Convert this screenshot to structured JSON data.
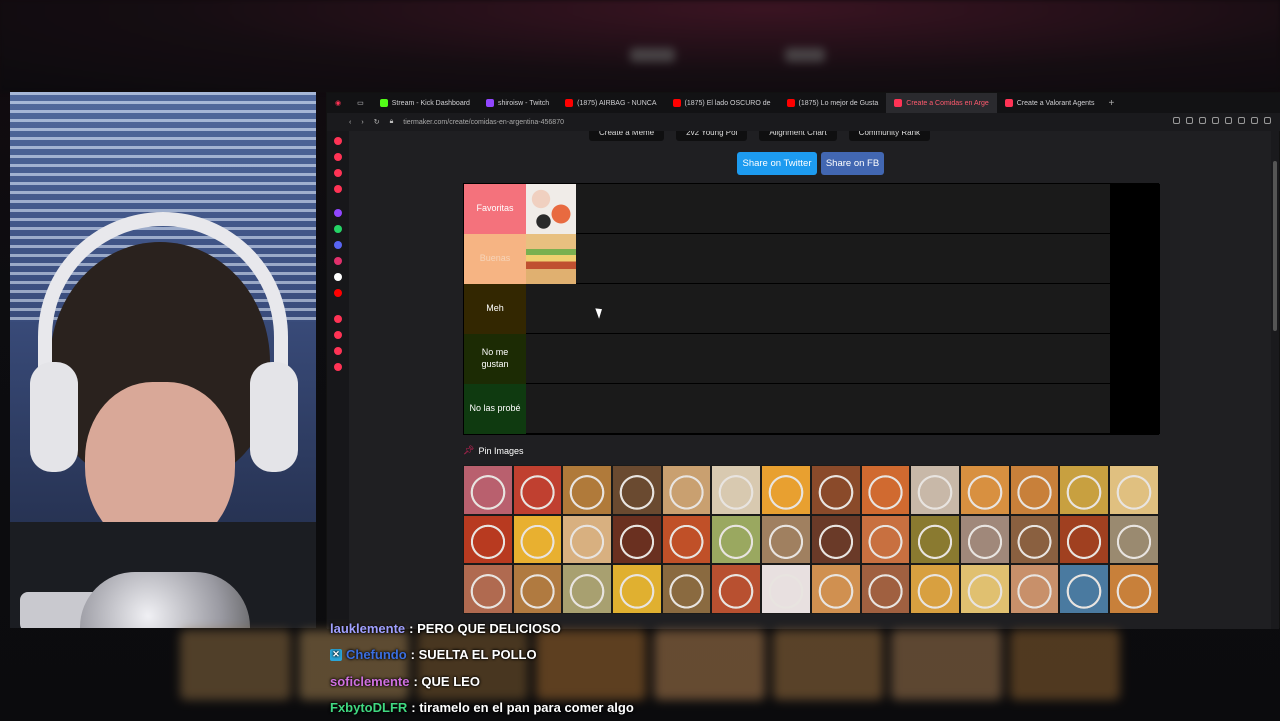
{
  "browser": {
    "tabs": [
      {
        "label": "Stream - Kick Dashboard",
        "color": "#53fc18",
        "active": false
      },
      {
        "label": "shiroisw - Twitch",
        "color": "#9146ff",
        "active": false
      },
      {
        "label": "(1875) AIRBAG - NUNCA",
        "color": "#ff0000",
        "active": false
      },
      {
        "label": "(1875) El lado OSCURO de",
        "color": "#ff0000",
        "active": false
      },
      {
        "label": "(1875) Lo mejor de Gusta",
        "color": "#ff0000",
        "active": false
      },
      {
        "label": "Create a Comidas en Arge",
        "color": "#ff3355",
        "active": true
      },
      {
        "label": "Create a Valorant Agents",
        "color": "#ff3355",
        "active": false
      }
    ],
    "newtab": "+",
    "url": "tiermaker.com/create/comidas-en-argentina-456870"
  },
  "page": {
    "topmenu": [
      "Create a Meme",
      "2v2 Young Pol",
      "Alignment Chart",
      "Community Rank"
    ],
    "share_twitter": "Share on Twitter",
    "share_fb": "Share on FB",
    "tiers": [
      {
        "label": "Favoritas",
        "color": "#f4727c",
        "items": [
          "sushi"
        ]
      },
      {
        "label": "Buenas",
        "color": "#f6b483",
        "items": [
          "sandwich"
        ]
      },
      {
        "label": "Meh",
        "color": "#332701",
        "items": []
      },
      {
        "label": "No me gustan",
        "color": "#1c2b04",
        "items": []
      },
      {
        "label": "No las probé",
        "color": "#0f3a10",
        "items": []
      }
    ],
    "pin_label": "Pin Images"
  },
  "pool_colors": [
    "#b9606e",
    "#c04030",
    "#b07a3a",
    "#6a4a30",
    "#c9a070",
    "#d8c9b0",
    "#e8a030",
    "#8a4a2a",
    "#d06a30",
    "#c8b8a8",
    "#d89040",
    "#c8803a",
    "#c8a040",
    "#e0c080",
    "#b83a20",
    "#e8b030",
    "#d8b080",
    "#6a3020",
    "#c05028",
    "#9aa860",
    "#a08060",
    "#6a3a28",
    "#c87040",
    "#8a7a30",
    "#a0887a",
    "#8a6040",
    "#a04020",
    "#9a8a70",
    "#b06a50",
    "#b07a40",
    "#a8a070",
    "#e0b030",
    "#8a6a40",
    "#b85030",
    "#e8e0e0",
    "#d09050",
    "#a06040",
    "#d8a040",
    "#e0c070",
    "#c8906a",
    "#4a7aa0",
    "#c8803a"
  ],
  "chat": [
    {
      "user": "lauklemente",
      "user_color": "#a0a0ff",
      "message": ": PERO QUE DELICIOSO",
      "badge": false
    },
    {
      "user": "Chefundo",
      "user_color": "#3b6fe0",
      "message": ": SUELTA EL POLLO",
      "badge": true
    },
    {
      "user": "soficlemente",
      "user_color": "#d070e0",
      "message": ": QUE LEO",
      "badge": false
    },
    {
      "user": "FxbytoDLFR",
      "user_color": "#40d880",
      "message": ": tiramelo en el pan para comer algo",
      "badge": false
    }
  ]
}
